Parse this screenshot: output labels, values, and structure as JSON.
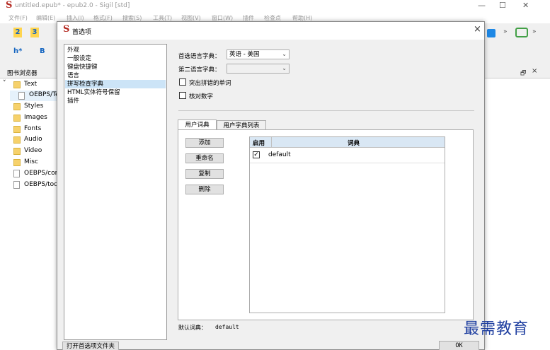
{
  "app": {
    "title": "untitled.epub* - epub2.0 - Sigil [std]",
    "menu": [
      "文件(F)",
      "编辑(E)",
      "插入(I)",
      "格式(F)",
      "搜索(S)",
      "工具(T)",
      "视图(V)",
      "窗口(W)",
      "插件",
      "检查点",
      "帮助(H)"
    ],
    "toolbar": {
      "heading_label": "h*",
      "bold_label": "B",
      "chapter2_label": "2",
      "chapter3_label": "3"
    }
  },
  "book_browser": {
    "title": "图书浏览器",
    "items": [
      {
        "label": "Text",
        "kind": "folder-open"
      },
      {
        "label": "OEBPS/Te",
        "kind": "file"
      },
      {
        "label": "Styles",
        "kind": "folder"
      },
      {
        "label": "Images",
        "kind": "folder"
      },
      {
        "label": "Fonts",
        "kind": "folder"
      },
      {
        "label": "Audio",
        "kind": "folder"
      },
      {
        "label": "Video",
        "kind": "folder"
      },
      {
        "label": "Misc",
        "kind": "folder"
      },
      {
        "label": "OEBPS/con",
        "kind": "file"
      },
      {
        "label": "OEBPS/toc",
        "kind": "file"
      }
    ]
  },
  "right_panel": {
    "float_glyph": "🗗",
    "close_glyph": "×"
  },
  "dialog": {
    "title": "首选项",
    "close_glyph": "×",
    "categories": [
      "外观",
      "一般设定",
      "键盘快捷键",
      "语言",
      "拼写检查字典",
      "HTML实体符号保留",
      "插件"
    ],
    "selected_category": "拼写检查字典",
    "primary_dict_label": "首选语言字典：",
    "primary_dict_value": "英语 - 美国",
    "secondary_dict_label": "第二语言字典：",
    "secondary_dict_value": "",
    "highlight_misspelled_label": "突出拼错的单词",
    "check_numbers_label": "核对数字",
    "tabs": [
      "用户词典",
      "用户字典列表"
    ],
    "active_tab": "用户词典",
    "buttons": {
      "add": "添加",
      "rename": "重命名",
      "copy": "复制",
      "delete": "删除"
    },
    "table": {
      "headers": [
        "启用",
        "词典"
      ],
      "rows": [
        {
          "enabled": true,
          "name": "default"
        }
      ]
    },
    "default_dict_label": "默认词典：",
    "default_dict_value": "default",
    "open_folder_label": "打开首选项文件夹",
    "ok_label": "OK"
  },
  "watermark": "最需教育"
}
